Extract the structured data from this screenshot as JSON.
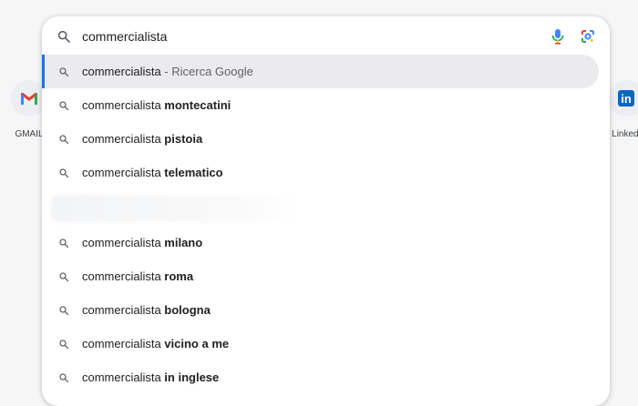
{
  "shortcuts": {
    "left": {
      "label": "GMAIL",
      "icon": "gmail-icon",
      "brand_color": "#d93025"
    },
    "right": {
      "label": "Linkedi",
      "icon": "linkedin-icon",
      "brand_color": "#0a66c2"
    }
  },
  "search": {
    "query": "commercialista",
    "icons": [
      "search-icon",
      "microphone-icon",
      "google-lens-icon"
    ]
  },
  "suggestions": [
    {
      "base": "commercialista",
      "bold": "",
      "suffix": " - Ricerca Google",
      "selected": true
    },
    {
      "base": "commercialista ",
      "bold": "montecatini",
      "suffix": ""
    },
    {
      "base": "commercialista ",
      "bold": "pistoia",
      "suffix": ""
    },
    {
      "base": "commercialista ",
      "bold": "telematico",
      "suffix": ""
    },
    {
      "base": "commercialista ",
      "bold": "milano",
      "suffix": ""
    },
    {
      "base": "commercialista ",
      "bold": "roma",
      "suffix": ""
    },
    {
      "base": "commercialista ",
      "bold": "bologna",
      "suffix": ""
    },
    {
      "base": "commercialista ",
      "bold": "vicino a me",
      "suffix": ""
    },
    {
      "base": "commercialista ",
      "bold": "in inglese",
      "suffix": ""
    }
  ],
  "colors": {
    "accent": "#1a73e8",
    "selected_bg": "#ebebed"
  }
}
